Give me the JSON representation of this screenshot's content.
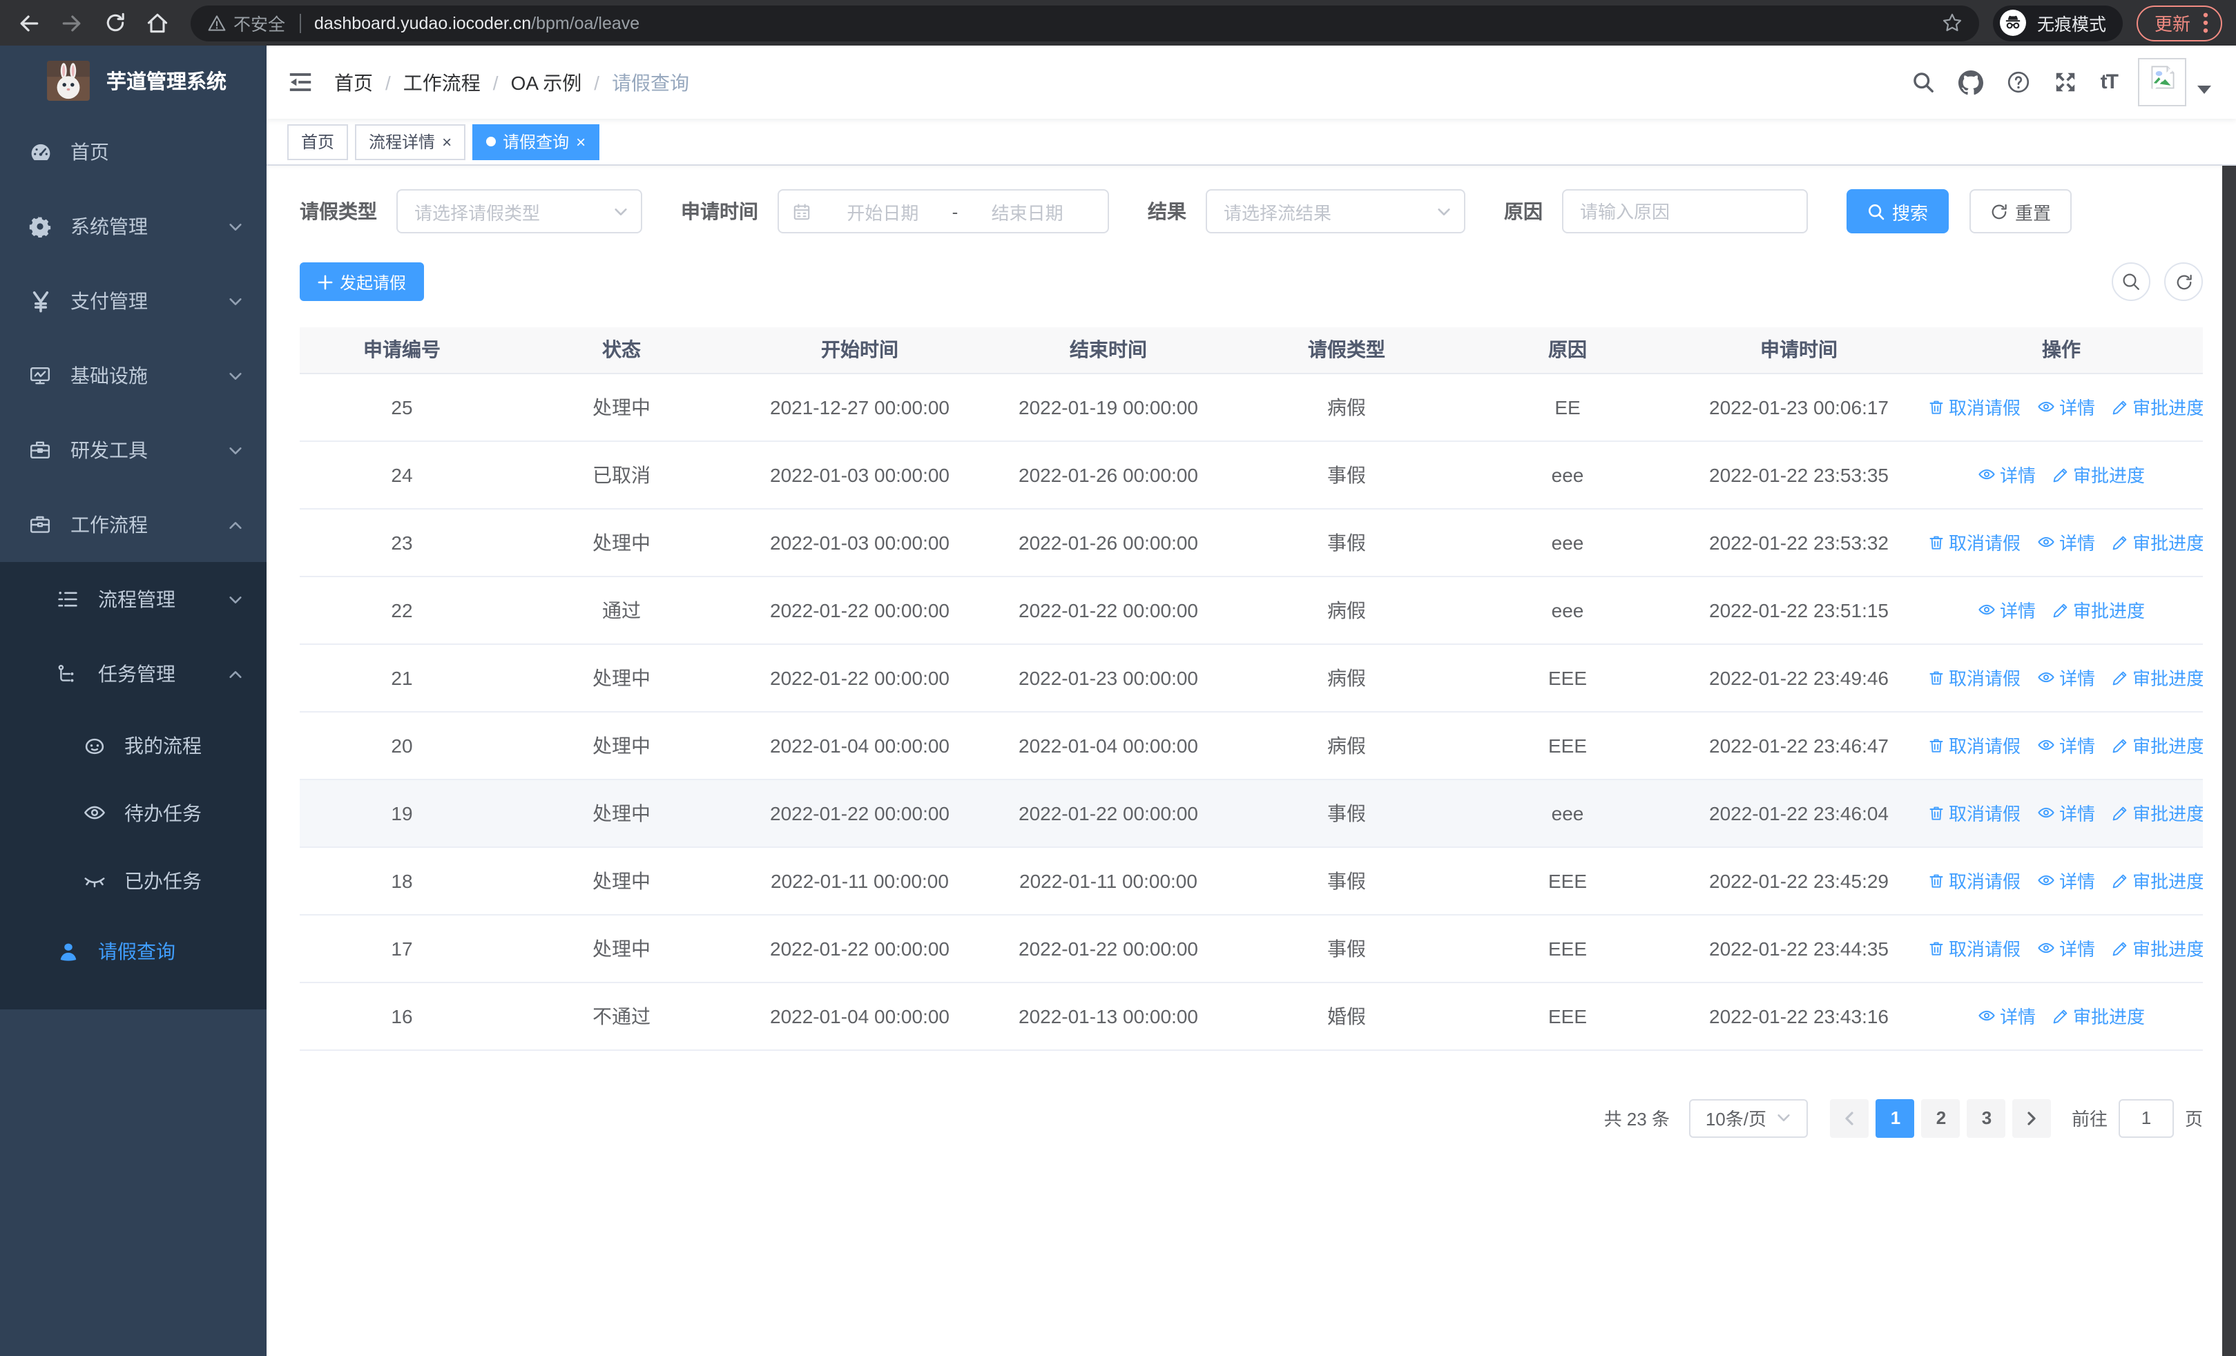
{
  "colors": {
    "accent": "#409eff",
    "sidebar_bg": "#304156",
    "sidebar_submenu_bg": "#1f2d3d",
    "sidebar_text": "#bfcbd9",
    "update_badge": "#f28b82",
    "table_header_bg": "#f8f8f9",
    "row_hover_bg": "#f5f7fa"
  },
  "browser": {
    "insecure_label": "不安全",
    "url_host": "dashboard.yudao.iocoder.cn",
    "url_path": "/bpm/oa/leave",
    "incognito_label": "无痕模式",
    "update_label": "更新"
  },
  "sidebar": {
    "app_title": "芋道管理系统",
    "items": [
      {
        "key": "home",
        "label": "首页",
        "icon": "dashboard-icon",
        "level": 1,
        "in_submenu": false
      },
      {
        "key": "system",
        "label": "系统管理",
        "icon": "gear-icon",
        "level": 1,
        "arrow": "down",
        "in_submenu": false
      },
      {
        "key": "payment",
        "label": "支付管理",
        "icon": "yen-icon",
        "level": 1,
        "arrow": "down",
        "in_submenu": false
      },
      {
        "key": "infra",
        "label": "基础设施",
        "icon": "monitor-icon",
        "level": 1,
        "arrow": "down",
        "in_submenu": false
      },
      {
        "key": "devtools",
        "label": "研发工具",
        "icon": "toolbox-icon",
        "level": 1,
        "arrow": "down",
        "in_submenu": false
      },
      {
        "key": "workflow",
        "label": "工作流程",
        "icon": "workflow-case-icon",
        "level": 1,
        "arrow": "up",
        "in_submenu": false
      },
      {
        "key": "process-mgmt",
        "label": "流程管理",
        "icon": "list-tree-icon",
        "level": 2,
        "arrow": "down",
        "in_submenu": true
      },
      {
        "key": "task-mgmt",
        "label": "任务管理",
        "icon": "flow-node-icon",
        "level": 2,
        "arrow": "up",
        "in_submenu": true
      },
      {
        "key": "my-process",
        "label": "我的流程",
        "icon": "robot-face-icon",
        "level": 3,
        "in_submenu": true
      },
      {
        "key": "todo-tasks",
        "label": "待办任务",
        "icon": "eye-open-icon",
        "level": 3,
        "in_submenu": true
      },
      {
        "key": "done-tasks",
        "label": "已办任务",
        "icon": "eye-closed-icon",
        "level": 3,
        "in_submenu": true
      },
      {
        "key": "leave-query",
        "label": "请假查询",
        "icon": "person-icon",
        "level": 2,
        "active": true,
        "in_submenu": true
      }
    ]
  },
  "header": {
    "breadcrumbs": [
      "首页",
      "工作流程",
      "OA 示例",
      "请假查询"
    ],
    "font_size_glyph": "tT"
  },
  "tabs": [
    {
      "key": "home",
      "label": "首页",
      "closable": false,
      "active": false
    },
    {
      "key": "process-detail",
      "label": "流程详情",
      "closable": true,
      "active": false
    },
    {
      "key": "leave-query",
      "label": "请假查询",
      "closable": true,
      "active": true
    }
  ],
  "filters": {
    "leave_type_label": "请假类型",
    "leave_type_placeholder": "请选择请假类型",
    "apply_time_label": "申请时间",
    "start_date_placeholder": "开始日期",
    "date_separator": "-",
    "end_date_placeholder": "结束日期",
    "result_label": "结果",
    "result_placeholder": "请选择流结果",
    "reason_label": "原因",
    "reason_placeholder": "请输入原因",
    "search_label": "搜索",
    "reset_label": "重置"
  },
  "toolbar": {
    "create_label": "发起请假"
  },
  "table": {
    "columns": [
      "申请编号",
      "状态",
      "开始时间",
      "结束时间",
      "请假类型",
      "原因",
      "申请时间",
      "操作"
    ],
    "field_order": [
      "id",
      "status",
      "start",
      "end",
      "type",
      "reason",
      "applied"
    ],
    "actions_def": {
      "cancel": {
        "label": "取消请假",
        "icon": "trash-icon",
        "name": "cancel-leave-link"
      },
      "detail": {
        "label": "详情",
        "icon": "eye-icon",
        "name": "detail-link"
      },
      "progress": {
        "label": "审批进度",
        "icon": "edit-icon",
        "name": "approval-progress-link"
      }
    },
    "rows": [
      {
        "id": "25",
        "status": "处理中",
        "start": "2021-12-27 00:00:00",
        "end": "2022-01-19 00:00:00",
        "type": "病假",
        "reason": "EE",
        "applied": "2022-01-23 00:06:17",
        "actions": [
          "cancel",
          "detail",
          "progress"
        ],
        "hover": false
      },
      {
        "id": "24",
        "status": "已取消",
        "start": "2022-01-03 00:00:00",
        "end": "2022-01-26 00:00:00",
        "type": "事假",
        "reason": "eee",
        "applied": "2022-01-22 23:53:35",
        "actions": [
          "detail",
          "progress"
        ],
        "hover": false
      },
      {
        "id": "23",
        "status": "处理中",
        "start": "2022-01-03 00:00:00",
        "end": "2022-01-26 00:00:00",
        "type": "事假",
        "reason": "eee",
        "applied": "2022-01-22 23:53:32",
        "actions": [
          "cancel",
          "detail",
          "progress"
        ],
        "hover": false
      },
      {
        "id": "22",
        "status": "通过",
        "start": "2022-01-22 00:00:00",
        "end": "2022-01-22 00:00:00",
        "type": "病假",
        "reason": "eee",
        "applied": "2022-01-22 23:51:15",
        "actions": [
          "detail",
          "progress"
        ],
        "hover": false
      },
      {
        "id": "21",
        "status": "处理中",
        "start": "2022-01-22 00:00:00",
        "end": "2022-01-23 00:00:00",
        "type": "病假",
        "reason": "EEE",
        "applied": "2022-01-22 23:49:46",
        "actions": [
          "cancel",
          "detail",
          "progress"
        ],
        "hover": false
      },
      {
        "id": "20",
        "status": "处理中",
        "start": "2022-01-04 00:00:00",
        "end": "2022-01-04 00:00:00",
        "type": "病假",
        "reason": "EEE",
        "applied": "2022-01-22 23:46:47",
        "actions": [
          "cancel",
          "detail",
          "progress"
        ],
        "hover": false
      },
      {
        "id": "19",
        "status": "处理中",
        "start": "2022-01-22 00:00:00",
        "end": "2022-01-22 00:00:00",
        "type": "事假",
        "reason": "eee",
        "applied": "2022-01-22 23:46:04",
        "actions": [
          "cancel",
          "detail",
          "progress"
        ],
        "hover": true
      },
      {
        "id": "18",
        "status": "处理中",
        "start": "2022-01-11 00:00:00",
        "end": "2022-01-11 00:00:00",
        "type": "事假",
        "reason": "EEE",
        "applied": "2022-01-22 23:45:29",
        "actions": [
          "cancel",
          "detail",
          "progress"
        ],
        "hover": false
      },
      {
        "id": "17",
        "status": "处理中",
        "start": "2022-01-22 00:00:00",
        "end": "2022-01-22 00:00:00",
        "type": "事假",
        "reason": "EEE",
        "applied": "2022-01-22 23:44:35",
        "actions": [
          "cancel",
          "detail",
          "progress"
        ],
        "hover": false
      },
      {
        "id": "16",
        "status": "不通过",
        "start": "2022-01-04 00:00:00",
        "end": "2022-01-13 00:00:00",
        "type": "婚假",
        "reason": "EEE",
        "applied": "2022-01-22 23:43:16",
        "actions": [
          "detail",
          "progress"
        ],
        "hover": false
      }
    ]
  },
  "pagination": {
    "total_label": "共 23 条",
    "page_size_label": "10条/页",
    "pages": [
      "1",
      "2",
      "3"
    ],
    "active_page": "1",
    "goto_label": "前往",
    "goto_value": "1",
    "page_unit_label": "页"
  }
}
